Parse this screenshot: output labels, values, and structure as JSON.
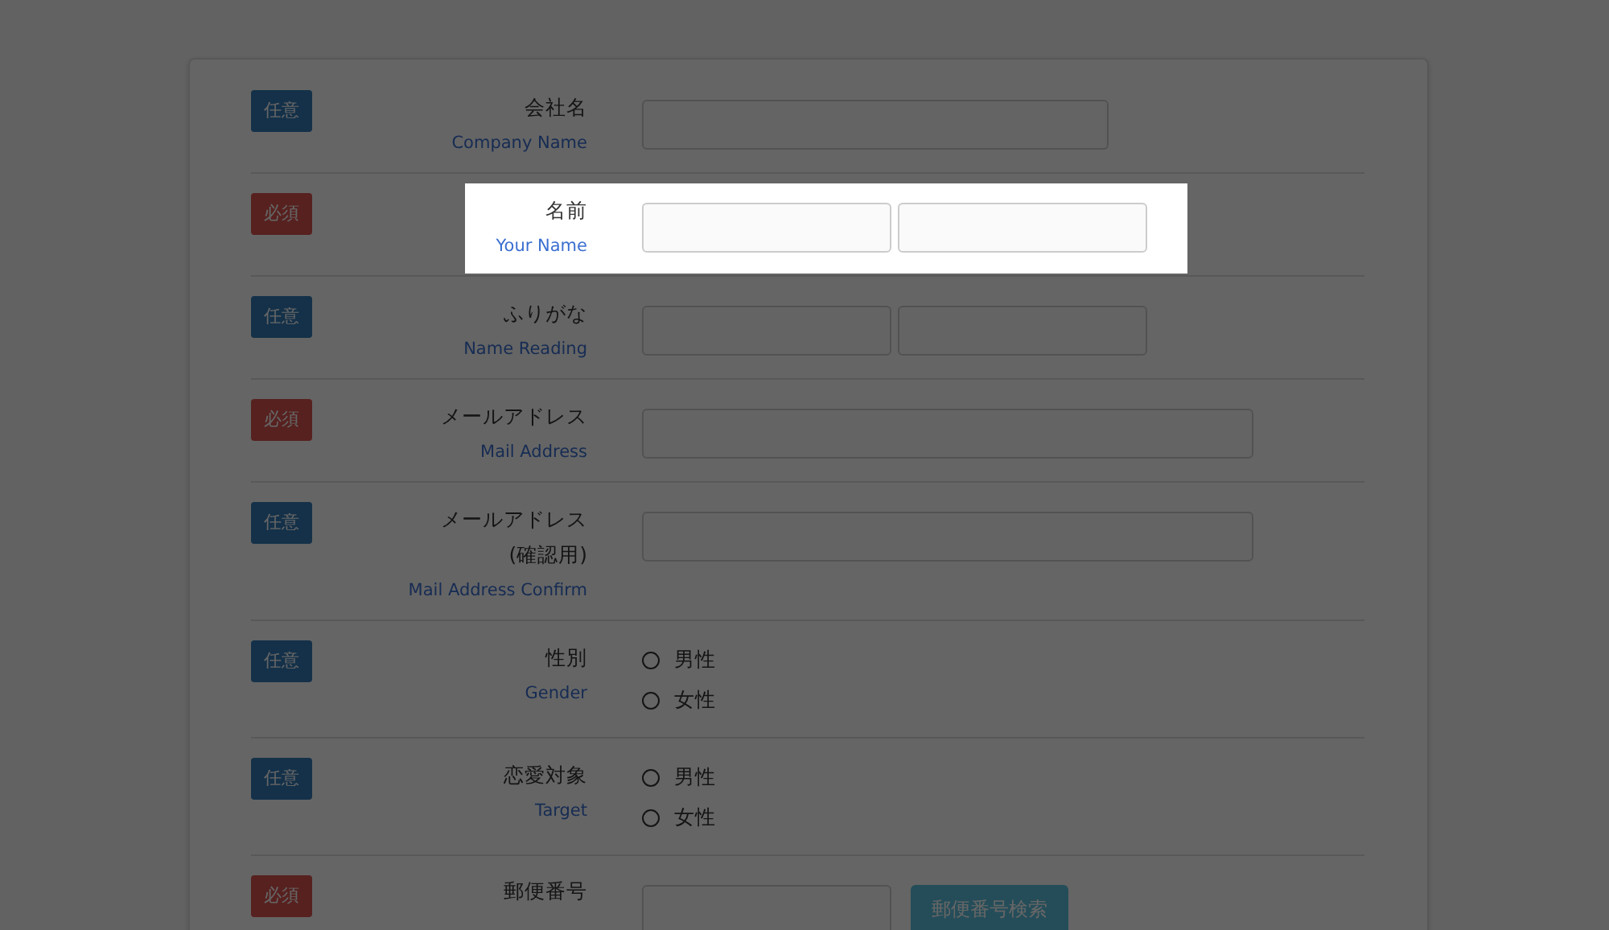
{
  "form": {
    "rows": [
      {
        "badge": {
          "text": "任意",
          "kind": "optional"
        },
        "label": [
          "会社名"
        ],
        "sublabel": "Company Name",
        "highlighted": false,
        "fields": [
          {
            "kind": "wide"
          }
        ]
      },
      {
        "badge": {
          "text": "必須",
          "kind": "required"
        },
        "label": [
          "名前"
        ],
        "sublabel": "Your Name",
        "highlighted": true,
        "fields": [
          {
            "kind": "half"
          },
          {
            "kind": "half"
          }
        ]
      },
      {
        "badge": {
          "text": "任意",
          "kind": "optional"
        },
        "label": [
          "ふりがな"
        ],
        "sublabel": "Name Reading",
        "highlighted": false,
        "fields": [
          {
            "kind": "half"
          },
          {
            "kind": "half"
          }
        ]
      },
      {
        "badge": {
          "text": "必須",
          "kind": "required"
        },
        "label": [
          "メールアドレス"
        ],
        "sublabel": "Mail Address",
        "highlighted": false,
        "fields": [
          {
            "kind": "full"
          }
        ]
      },
      {
        "badge": {
          "text": "任意",
          "kind": "optional"
        },
        "label": [
          "メールアドレス",
          "(確認用)"
        ],
        "sublabel": "Mail Address Confirm",
        "highlighted": false,
        "fields": [
          {
            "kind": "full"
          }
        ]
      },
      {
        "badge": {
          "text": "任意",
          "kind": "optional"
        },
        "label": [
          "性別"
        ],
        "sublabel": "Gender",
        "highlighted": false,
        "fields": [
          {
            "kind": "radio",
            "label": "男性",
            "selected": false
          },
          {
            "kind": "radio",
            "label": "女性",
            "selected": false
          }
        ]
      },
      {
        "badge": {
          "text": "任意",
          "kind": "optional"
        },
        "label": [
          "恋愛対象"
        ],
        "sublabel": "Target",
        "highlighted": false,
        "fields": [
          {
            "kind": "radio",
            "label": "男性",
            "selected": false
          },
          {
            "kind": "radio",
            "label": "女性",
            "selected": false
          }
        ]
      },
      {
        "badge": {
          "text": "必須",
          "kind": "required"
        },
        "label": [
          "郵便番号"
        ],
        "highlighted": false,
        "fields": [
          {
            "kind": "half"
          },
          {
            "kind": "button",
            "label": "郵便番号検索"
          }
        ]
      }
    ]
  }
}
